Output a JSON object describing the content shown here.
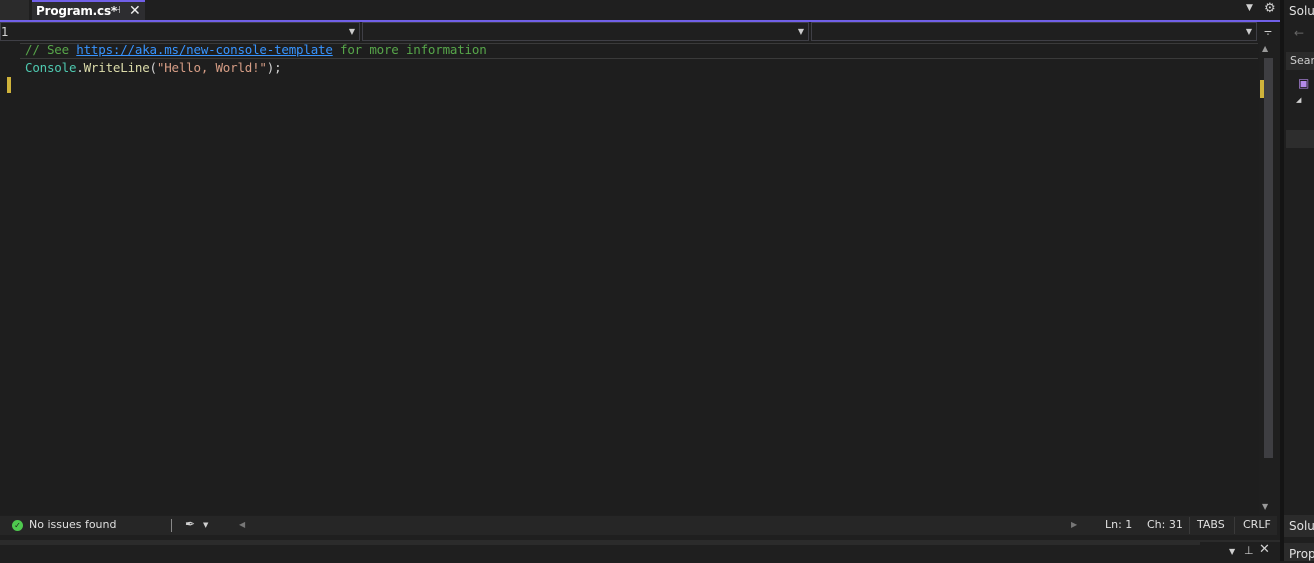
{
  "tabs": {
    "active": {
      "label": "Program.cs*",
      "pin_icon": "pin-icon",
      "close_icon": "close-icon"
    },
    "overflow_icon": "chevron-down-icon",
    "settings_icon": "gear-icon"
  },
  "navbar": {
    "project": "1",
    "type": "",
    "member": ""
  },
  "editor": {
    "line1": {
      "comment_prefix": "// See ",
      "url": "https://aka.ms/new-console-template",
      "comment_suffix": " for more information"
    },
    "line2": {
      "class": "Console",
      "dot": ".",
      "method": "WriteLine",
      "open": "(",
      "string": "\"Hello, World!\"",
      "close": ");"
    }
  },
  "status": {
    "issues": "No issues found",
    "ln": "Ln: 1",
    "ch": "Ch: 31",
    "tabs": "TABS",
    "eol": "CRLF"
  },
  "right_panel": {
    "title": "Solu",
    "search": "Searc",
    "tab_solution": "Solu",
    "tab_properties": "Prop"
  },
  "colors": {
    "accent": "#7160e8",
    "comment": "#57a64a",
    "link": "#3794ff",
    "class": "#4ec9b0",
    "method": "#dcdcaa",
    "string": "#d69d85",
    "change_marker": "#cfb33b",
    "ok": "#4ec94e"
  }
}
